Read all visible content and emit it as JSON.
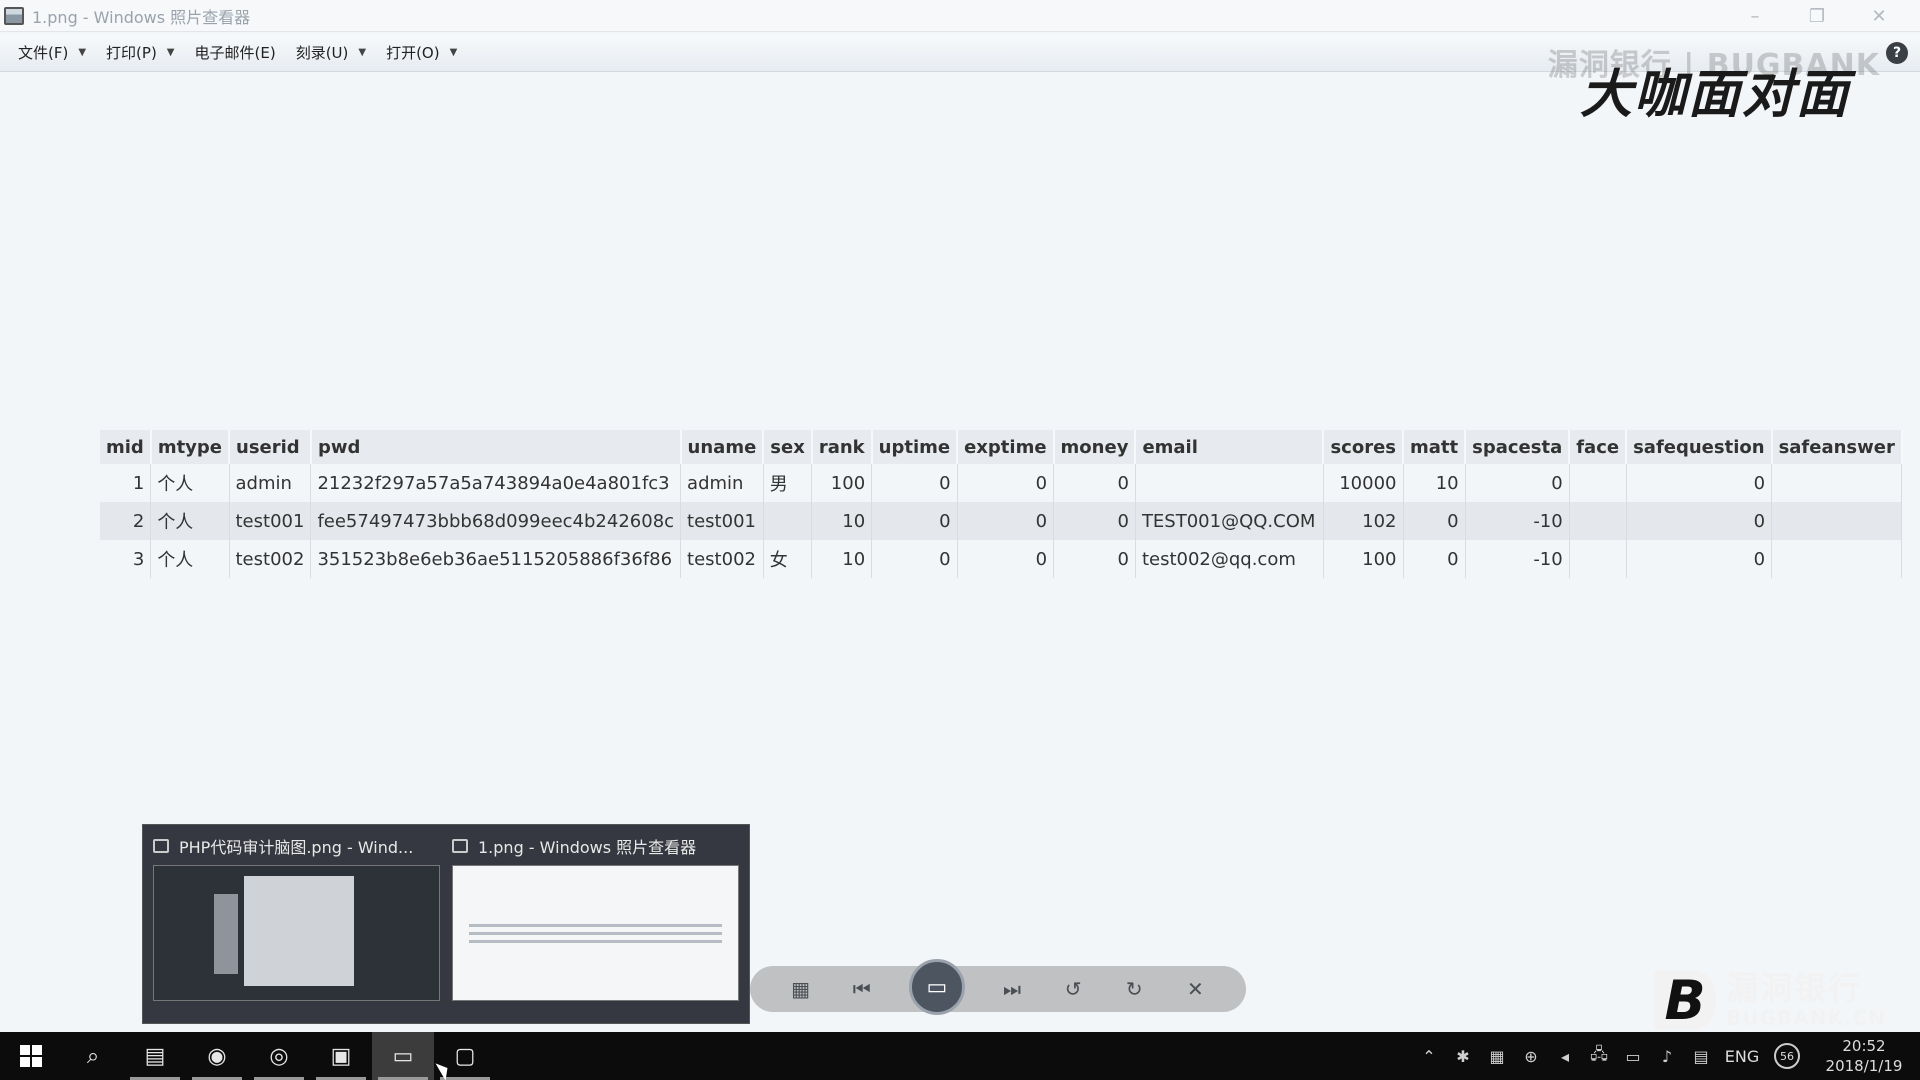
{
  "window": {
    "title": "1.png - Windows 照片查看器",
    "minimize": "–",
    "maximize": "❐",
    "close": "✕"
  },
  "menu": {
    "items": [
      {
        "label": "文件(F)",
        "has_dropdown": true
      },
      {
        "label": "打印(P)",
        "has_dropdown": true
      },
      {
        "label": "电子邮件(E)",
        "has_dropdown": false
      },
      {
        "label": "刻录(U)",
        "has_dropdown": true
      },
      {
        "label": "打开(O)",
        "has_dropdown": true
      }
    ],
    "help": "?"
  },
  "watermark": {
    "top": "漏洞银行 | BUGBANK",
    "big": "大咖面对面"
  },
  "table": {
    "columns": [
      "mid",
      "mtype",
      "userid",
      "pwd",
      "uname",
      "sex",
      "rank",
      "uptime",
      "exptime",
      "money",
      "email",
      "scores",
      "matt",
      "spacesta",
      "face",
      "safequestion",
      "safeanswer"
    ],
    "rows": [
      [
        "1",
        "个人",
        "admin",
        "21232f297a57a5a743894a0e4a801fc3",
        "admin",
        "男",
        "100",
        "0",
        "0",
        "0",
        "",
        "10000",
        "10",
        "0",
        "",
        "0",
        ""
      ],
      [
        "2",
        "个人",
        "test001",
        "fee57497473bbb68d099eec4b242608c",
        "test001",
        "",
        "10",
        "0",
        "0",
        "0",
        "TEST001@QQ.COM",
        "102",
        "0",
        "-10",
        "",
        "0",
        ""
      ],
      [
        "3",
        "个人",
        "test002",
        "351523b8e6eb36ae5115205886f36f86",
        "test002",
        "女",
        "10",
        "0",
        "0",
        "0",
        "test002@qq.com",
        "100",
        "0",
        "-10",
        "",
        "0",
        ""
      ]
    ],
    "selected_row": 1
  },
  "thumbnails": [
    {
      "title": "PHP代码审计脑图.png - Wind...",
      "theme": "dark"
    },
    {
      "title": "1.png - Windows 照片查看器",
      "theme": "light"
    }
  ],
  "viewer_toolbar": {
    "icons": [
      "gallery-icon",
      "previous-icon",
      "slideshow-icon",
      "next-icon",
      "rotate-left-icon",
      "rotate-right-icon",
      "delete-icon"
    ]
  },
  "taskbar": {
    "apps": [
      {
        "name": "start",
        "active": false,
        "pinned": false
      },
      {
        "name": "search",
        "active": false,
        "pinned": false
      },
      {
        "name": "file-explorer",
        "active": false,
        "pinned": true
      },
      {
        "name": "firefox",
        "active": false,
        "pinned": true
      },
      {
        "name": "chrome",
        "active": false,
        "pinned": true
      },
      {
        "name": "notes",
        "active": false,
        "pinned": true
      },
      {
        "name": "photo-viewer",
        "active": true,
        "pinned": true
      },
      {
        "name": "app",
        "active": false,
        "pinned": true
      }
    ],
    "tray": {
      "lang": "ENG",
      "badge": "56",
      "time": "20:52",
      "date": "2018/1/19"
    }
  },
  "logo": {
    "mark": "B",
    "cn": "漏洞银行",
    "en": "BUGBANK.CN"
  }
}
